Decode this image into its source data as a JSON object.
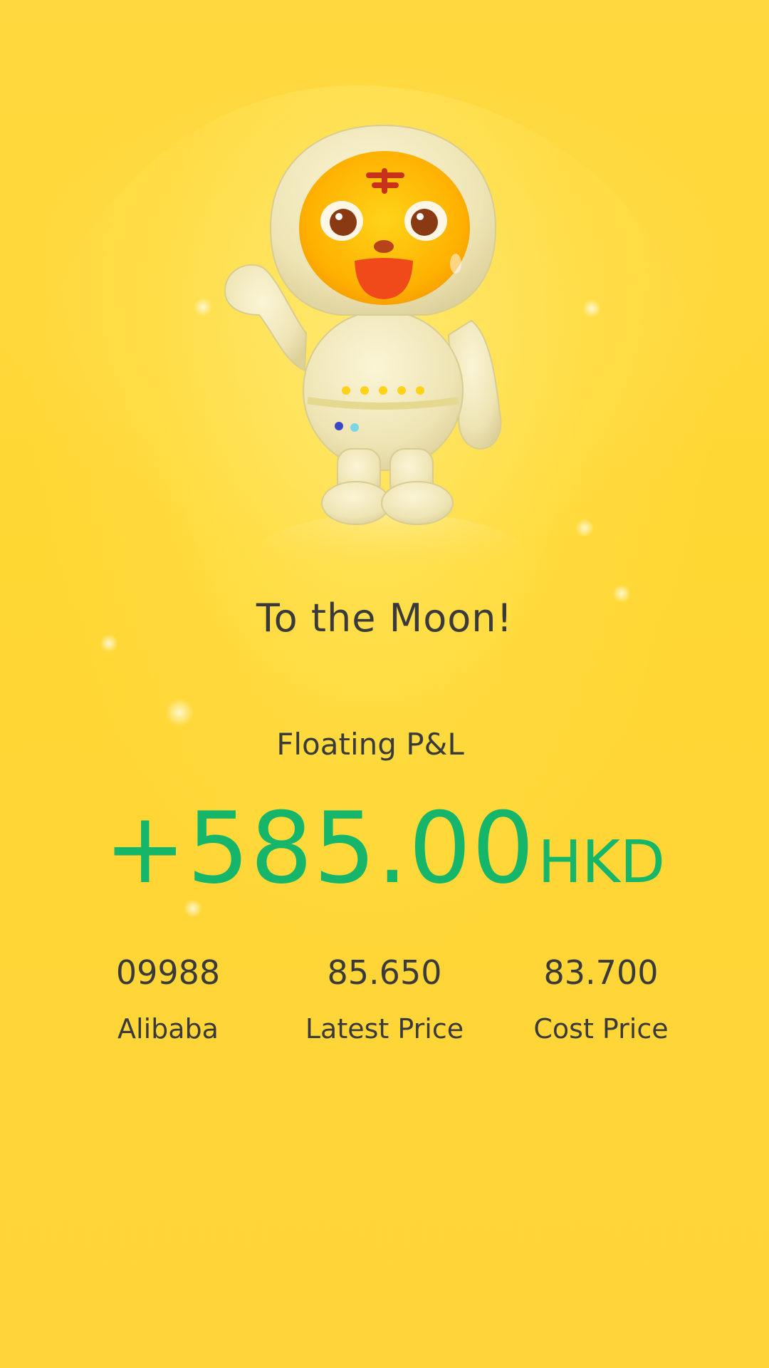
{
  "banner": {
    "title": "To the Moon!",
    "mascot": "tiger-astronaut-mascot"
  },
  "pnl": {
    "label": "Floating P&L",
    "amount": "+585.00",
    "currency": "HKD",
    "color": "#16b66a"
  },
  "stats": [
    {
      "value": "09988",
      "label": "Alibaba"
    },
    {
      "value": "85.650",
      "label": "Latest Price"
    },
    {
      "value": "83.700",
      "label": "Cost Price"
    }
  ],
  "theme": {
    "background": "#ffd733",
    "text": "#3a3a3a"
  }
}
